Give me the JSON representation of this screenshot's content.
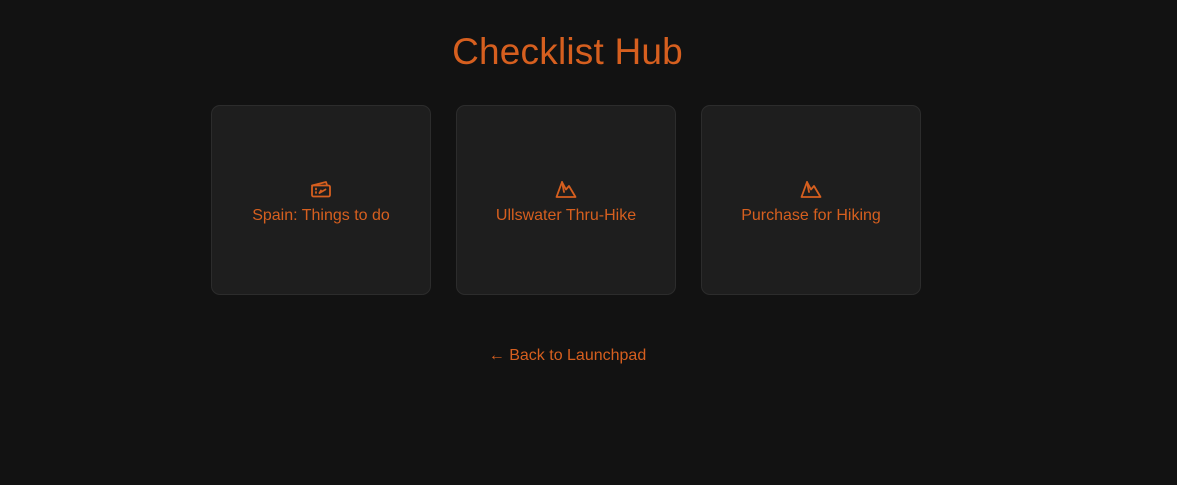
{
  "page": {
    "title": "Checklist Hub",
    "accent_color": "#d65f1f",
    "background_color": "#121212",
    "card_color": "#1e1e1e"
  },
  "cards": [
    {
      "label": "Spain: Things to do",
      "icon": "ticket-icon"
    },
    {
      "label": "Ullswater Thru-Hike",
      "icon": "mountain-icon"
    },
    {
      "label": "Purchase for Hiking",
      "icon": "mountain-icon"
    }
  ],
  "nav": {
    "back_label": "← Back to Launchpad"
  }
}
